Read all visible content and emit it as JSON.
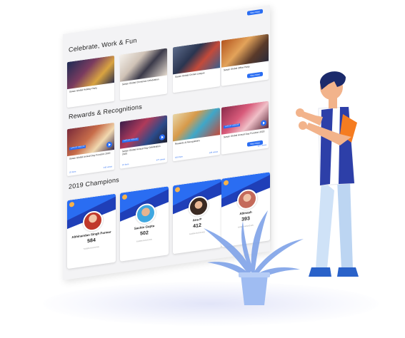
{
  "sections": {
    "celebrate": {
      "title": "Celebrate, Work & Fun",
      "view_more": "View More",
      "cards": [
        {
          "caption": "Sasan Global Holiday Party"
        },
        {
          "caption": "Sasan Global Christmas Celebration"
        },
        {
          "caption": "Sasan Global Cricket League"
        },
        {
          "caption": "Sasan Global Office Party"
        }
      ]
    },
    "rewards": {
      "title": "Rewards & Recognitions",
      "view_more": "View More",
      "cards": [
        {
          "tag": "LATEST VIDEOS",
          "caption": "Sasan Global Annual Day Function 2020",
          "left": "23 Item",
          "right": "445 views"
        },
        {
          "tag": "LATEST VIDEOS",
          "caption": "Sasan Global Annual Day Celebration 2020",
          "left": "57 Item",
          "right": "477 views"
        },
        {
          "caption": "Rewards & Recognitions",
          "left": "180 Item",
          "right": "126 views"
        },
        {
          "tag": "LATEST VIDEOS",
          "caption": "Sasan Global Annual Day Function 2020",
          "left": "",
          "right": "427 views"
        }
      ]
    },
    "champions": {
      "title": "2019 Champions",
      "view_more": "View More",
      "people": [
        {
          "name": "Abhinandan Singh Parmar",
          "score": "584",
          "sub": "SUBMISSIONS",
          "band": "#2a6df2",
          "avatar": "#c0392b"
        },
        {
          "name": "Sachin Gupta",
          "score": "502",
          "sub": "SUBMISSIONS",
          "band": "#2a6df2",
          "avatar": "#3fa7e0"
        },
        {
          "name": "Ana P",
          "score": "412",
          "sub": "SUBMISSIONS",
          "band": "#2a6df2",
          "avatar": "#5b3a2e"
        },
        {
          "name": "Abinash",
          "score": "393",
          "sub": "SUBMISSIONS",
          "band": "#2a6df2",
          "avatar": "#c46a5a"
        }
      ]
    }
  },
  "colors": {
    "accent": "#2a6df2",
    "dark_band": "#1f3fb8",
    "shirt": "#ffffff",
    "vest": "#2d3fa8",
    "sleeve": "#f57c20",
    "pants": "#cfe2f7",
    "shoes": "#2a62c9",
    "hair": "#1b2a6b",
    "skin": "#f2b38b",
    "plant": "#7fa3e8"
  }
}
